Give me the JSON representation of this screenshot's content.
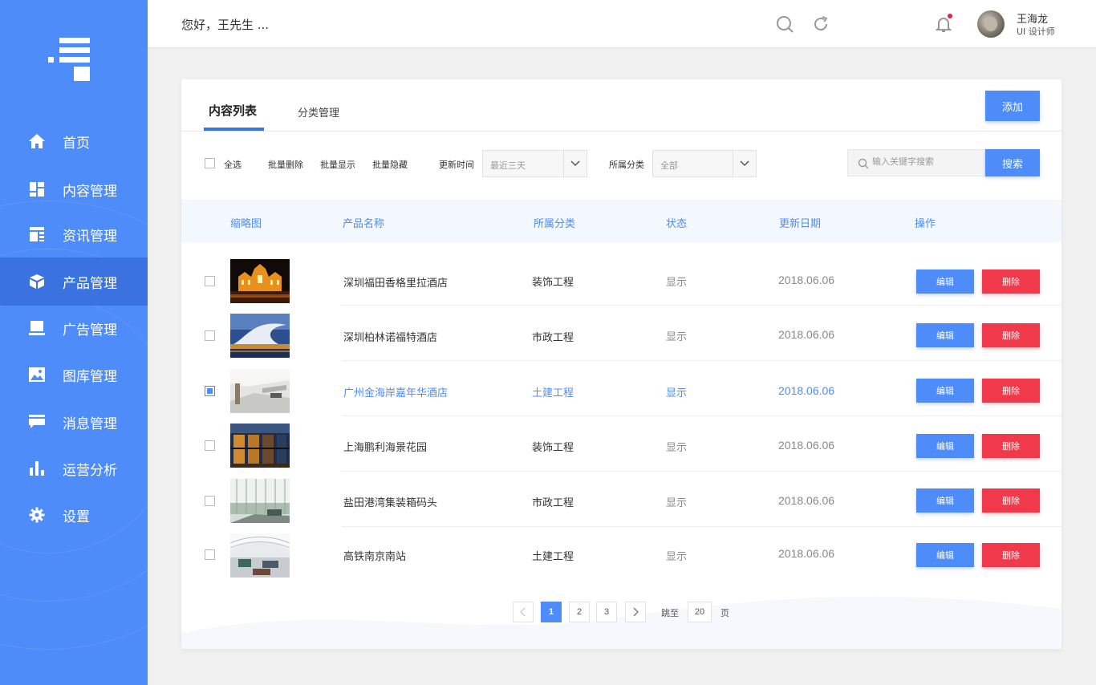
{
  "brand": {
    "accent": "#4e8cfa",
    "danger": "#f03a4c",
    "sidebar_bg": "#4e8cfa"
  },
  "sidebar": {
    "items": [
      {
        "label": "首页",
        "icon": "home-icon",
        "active": false
      },
      {
        "label": "内容管理",
        "icon": "dashboard-icon",
        "active": false
      },
      {
        "label": "资讯管理",
        "icon": "news-icon",
        "active": false
      },
      {
        "label": "产品管理",
        "icon": "cube-icon",
        "active": true
      },
      {
        "label": "广告管理",
        "icon": "monitor-icon",
        "active": false
      },
      {
        "label": "图库管理",
        "icon": "image-icon",
        "active": false
      },
      {
        "label": "消息管理",
        "icon": "message-icon",
        "active": false
      },
      {
        "label": "运营分析",
        "icon": "bar-chart-icon",
        "active": false
      },
      {
        "label": "设置",
        "icon": "gear-icon",
        "active": false
      }
    ]
  },
  "header": {
    "greeting": "您好，王先生 ...",
    "user": {
      "name": "王海龙",
      "role": "UI 设计师"
    },
    "has_notification": true
  },
  "tabs": [
    {
      "label": "内容列表",
      "active": true
    },
    {
      "label": "分类管理",
      "active": false
    }
  ],
  "actions": {
    "add_label": "添加"
  },
  "toolbar": {
    "select_all": "全选",
    "batch_delete": "批量删除",
    "batch_show": "批量显示",
    "batch_hide": "批量隐藏",
    "update_time_label": "更新时间",
    "update_time_value": "最近三天",
    "category_label": "所属分类",
    "category_value": "全部",
    "search_placeholder": "输入关键字搜索",
    "search_button": "搜索"
  },
  "table": {
    "headers": [
      "缩略图",
      "产品名称",
      "所属分类",
      "状态",
      "更新日期",
      "操作"
    ],
    "edit_label": "编辑",
    "delete_label": "删除",
    "rows": [
      {
        "name": "深圳福田香格里拉酒店",
        "category": "装饰工程",
        "status": "显示",
        "date": "2018.06.06",
        "checked": false,
        "thumb": "night-castle-photo"
      },
      {
        "name": "深圳柏林诺福特酒店",
        "category": "市政工程",
        "status": "显示",
        "date": "2018.06.06",
        "checked": false,
        "thumb": "opera-house-photo"
      },
      {
        "name": "广州金海岸嘉年华酒店",
        "category": "土建工程",
        "status": "显示",
        "date": "2018.06.06",
        "checked": true,
        "thumb": "white-interior-photo"
      },
      {
        "name": "上海鹏利海景花园",
        "category": "装饰工程",
        "status": "显示",
        "date": "2018.06.06",
        "checked": false,
        "thumb": "glass-facade-photo"
      },
      {
        "name": "盐田港湾集装箱码头",
        "category": "市政工程",
        "status": "显示",
        "date": "2018.06.06",
        "checked": false,
        "thumb": "glass-hall-photo"
      },
      {
        "name": "高铁南京南站",
        "category": "土建工程",
        "status": "显示",
        "date": "2018.06.06",
        "checked": false,
        "thumb": "station-interior-photo"
      }
    ]
  },
  "pagination": {
    "pages": [
      "1",
      "2",
      "3"
    ],
    "current": "1",
    "jump_label": "跳至",
    "jump_value": "20",
    "page_suffix": "页"
  }
}
